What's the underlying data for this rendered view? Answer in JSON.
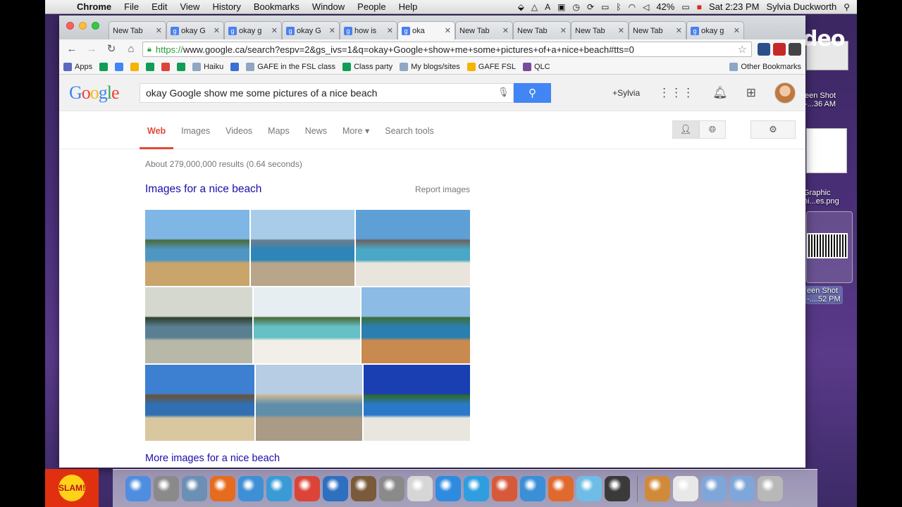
{
  "menubar": {
    "apple": "",
    "app": "Chrome",
    "items": [
      "File",
      "Edit",
      "View",
      "History",
      "Bookmarks",
      "Window",
      "People",
      "Help"
    ],
    "battery": "42%",
    "clock": "Sat 2:23 PM",
    "user": "Sylvia Duckworth"
  },
  "tabs": [
    {
      "label": "New Tab",
      "favicon": false,
      "active": false
    },
    {
      "label": "okay G",
      "favicon": true,
      "active": false
    },
    {
      "label": "okay g",
      "favicon": true,
      "active": false
    },
    {
      "label": "okay G",
      "favicon": true,
      "active": false
    },
    {
      "label": "how is",
      "favicon": true,
      "active": false
    },
    {
      "label": "oka",
      "favicon": true,
      "active": true
    },
    {
      "label": "New Tab",
      "favicon": false,
      "active": false
    },
    {
      "label": "New Tab",
      "favicon": false,
      "active": false
    },
    {
      "label": "New Tab",
      "favicon": false,
      "active": false
    },
    {
      "label": "New Tab",
      "favicon": false,
      "active": false
    },
    {
      "label": "okay g",
      "favicon": true,
      "active": false
    }
  ],
  "omnibox": {
    "scheme": "https://",
    "rest": "www.google.ca/search?espv=2&gs_ivs=1&q=okay+Google+show+me+some+pictures+of+a+nice+beach#tts=0"
  },
  "bookmarks": [
    {
      "label": "Apps",
      "color": "#5b6abf"
    },
    {
      "label": "",
      "color": "#0f9d58"
    },
    {
      "label": "",
      "color": "#4285f4"
    },
    {
      "label": "",
      "color": "#f4b400"
    },
    {
      "label": "",
      "color": "#0f9d58"
    },
    {
      "label": "",
      "color": "#db4437"
    },
    {
      "label": "",
      "color": "#0f9d58"
    },
    {
      "label": "Haiku",
      "color": "#8fa6c4"
    },
    {
      "label": "",
      "color": "#3b6fd8"
    },
    {
      "label": "GAFE in the FSL class",
      "color": "#8fa6c4"
    },
    {
      "label": "Class party",
      "color": "#0f9d58"
    },
    {
      "label": "My blogs/sites",
      "color": "#8fa6c4"
    },
    {
      "label": "GAFE FSL",
      "color": "#f4b400"
    },
    {
      "label": "QLC",
      "color": "#7a4b9c"
    }
  ],
  "other_bookmarks": "Other Bookmarks",
  "google": {
    "logo": [
      "G",
      "o",
      "o",
      "g",
      "l",
      "e"
    ],
    "query": "okay Google show me some pictures of a nice beach",
    "plus_user": "+Sylvia",
    "nav": [
      "Web",
      "Images",
      "Videos",
      "Maps",
      "News",
      "More ▾",
      "Search tools"
    ],
    "result_count": "About 279,000,000 results (0.64 seconds)",
    "images_title": "Images for a nice beach",
    "report_images": "Report images",
    "more_images": "More images for a nice beach"
  },
  "image_rows": [
    [
      {
        "w": 148,
        "sky": "#7fb6e6",
        "sea": "#4f97c2",
        "sand": "#c9a46b",
        "accent": "#4a6b3a"
      },
      {
        "w": 147,
        "sky": "#a9cde8",
        "sea": "#2e86b8",
        "sand": "#b8a58a",
        "accent": "#6d7d8c"
      },
      {
        "w": 162,
        "sky": "#5e9fd6",
        "sea": "#4aa8c6",
        "sand": "#e9e4dc",
        "accent": "#6a6260"
      }
    ],
    [
      {
        "w": 152,
        "sky": "#d5d8cf",
        "sea": "#5a7f93",
        "sand": "#b8b8a8",
        "accent": "#2f3e2c"
      },
      {
        "w": 151,
        "sky": "#e6eef2",
        "sea": "#65c1c6",
        "sand": "#f2efe8",
        "accent": "#4c6a3a"
      },
      {
        "w": 154,
        "sky": "#8cbce6",
        "sea": "#2a7fb0",
        "sand": "#c98a4f",
        "accent": "#3d6e3a"
      }
    ],
    [
      {
        "w": 155,
        "sky": "#3d7fd0",
        "sea": "#2f6fb2",
        "sand": "#d9c7a0",
        "accent": "#6d5232"
      },
      {
        "w": 151,
        "sky": "#b6cde3",
        "sea": "#5f8eaa",
        "sand": "#a99b86",
        "accent": "#c9b895"
      },
      {
        "w": 151,
        "sky": "#1a3fb3",
        "sea": "#2a78c9",
        "sand": "#e8e6de",
        "accent": "#2f6a2a"
      }
    ]
  ],
  "dock_icons": [
    {
      "name": "finder-icon",
      "color": "#4f8de0"
    },
    {
      "name": "launchpad-icon",
      "color": "#8a8a8a"
    },
    {
      "name": "preview-icon",
      "color": "#6b8fb5"
    },
    {
      "name": "firefox-icon",
      "color": "#e66b1e"
    },
    {
      "name": "word-icon",
      "color": "#3e8fd6"
    },
    {
      "name": "safari-icon",
      "color": "#3a9ad6"
    },
    {
      "name": "chrome-icon",
      "color": "#db4437"
    },
    {
      "name": "quicktime-icon",
      "color": "#2e6fbf"
    },
    {
      "name": "photo-booth-icon",
      "color": "#7a5a3a"
    },
    {
      "name": "system-preferences-icon",
      "color": "#8a8a8a"
    },
    {
      "name": "dvd-player-icon",
      "color": "#d6d6d6"
    },
    {
      "name": "app-store-icon",
      "color": "#2e8be0"
    },
    {
      "name": "twitter-icon",
      "color": "#2f9ee0"
    },
    {
      "name": "photos-icon",
      "color": "#d65a3a"
    },
    {
      "name": "notes-icon",
      "color": "#3a8fd6"
    },
    {
      "name": "powerpoint-icon",
      "color": "#e06a2e"
    },
    {
      "name": "messages-icon",
      "color": "#6fbde6"
    },
    {
      "name": "imovie-icon",
      "color": "#3a3a3a"
    },
    {
      "name": "document-icon",
      "color": "#d08a3a"
    },
    {
      "name": "png-file-icon",
      "color": "#e8e8e8"
    },
    {
      "name": "applications-folder-icon",
      "color": "#7fa6d8"
    },
    {
      "name": "documents-folder-icon",
      "color": "#7fa6d8"
    },
    {
      "name": "trash-icon",
      "color": "#b8b8b8"
    }
  ],
  "desktop_files": [
    {
      "label": "een Shot\n-...36 AM"
    },
    {
      "label": "Graphic\nni...es.png"
    },
    {
      "label": "een Shot\n-....52 PM"
    }
  ],
  "watermark": "weVideo",
  "slam_logo": "SLAM!"
}
